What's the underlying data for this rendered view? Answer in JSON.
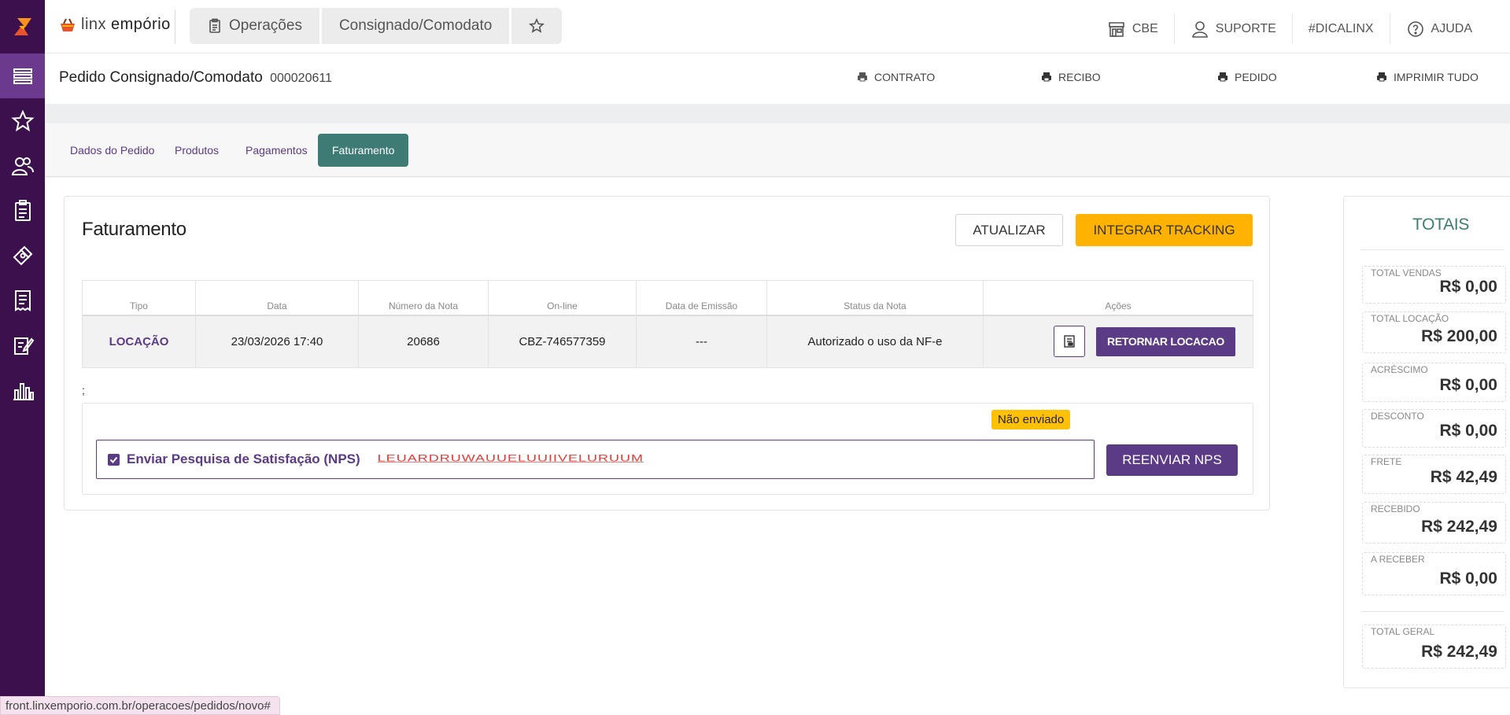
{
  "brand": {
    "name_a": "linx",
    "name_b": "empório"
  },
  "breadcrumb": [
    "Operações",
    "Consignado/Comodato"
  ],
  "topbar": {
    "cbe": "CBE",
    "suporte": "SUPORTE",
    "dicalinx": "#DICALINX",
    "ajuda": "AJUDA"
  },
  "page": {
    "title": "Pedido Consignado/Comodato",
    "number": "000020611",
    "actions": {
      "contrato": "CONTRATO",
      "recibo": "RECIBO",
      "pedido": "PEDIDO",
      "imprimir": "IMPRIMIR TUDO"
    }
  },
  "tabs": [
    "Dados do Pedido",
    "Produtos",
    "Pagamentos",
    "Faturamento"
  ],
  "faturamento": {
    "title": "Faturamento",
    "atualizar": "ATUALIZAR",
    "integrar": "INTEGRAR TRACKING",
    "columns": [
      "Tipo",
      "Data",
      "Número da Nota",
      "On-line",
      "Data de Emissão",
      "Status da Nota",
      "Ações"
    ],
    "row": {
      "tipo": "LOCAÇÃO",
      "data": "23/03/2026 17:40",
      "numero": "20686",
      "online": "CBZ-746577359",
      "emissao": "---",
      "status": "Autorizado o uso da NF-e",
      "retornar": "RETORNAR LOCACAO"
    },
    "semicolon": ";",
    "nps": {
      "badge": "Não enviado",
      "label": "Enviar Pesquisa de Satisfação (NPS)",
      "email": "LEUARDRUWAUUELUUIIVELURUUM",
      "reenviar": "REENVIAR NPS"
    }
  },
  "totais": {
    "title": "TOTAIS",
    "items": [
      {
        "label": "TOTAL VENDAS",
        "value": "R$ 0,00"
      },
      {
        "label": "TOTAL LOCAÇÃO",
        "value": "R$ 200,00"
      },
      {
        "label": "ACRÉSCIMO",
        "value": "R$ 0,00"
      },
      {
        "label": "DESCONTO",
        "value": "R$ 0,00"
      },
      {
        "label": "FRETE",
        "value": "R$ 42,49"
      },
      {
        "label": "RECEBIDO",
        "value": "R$ 242,49"
      },
      {
        "label": "A RECEBER",
        "value": "R$ 0,00"
      }
    ],
    "geral": {
      "label": "TOTAL GERAL",
      "value": "R$ 242,49"
    }
  },
  "statusbar": "front.linxemporio.com.br/operacoes/pedidos/novo#",
  "colors": {
    "sidebar": "#3c0f4d",
    "primary": "#5b3a86",
    "teal": "#3d7b74",
    "warning": "#ffb300"
  }
}
